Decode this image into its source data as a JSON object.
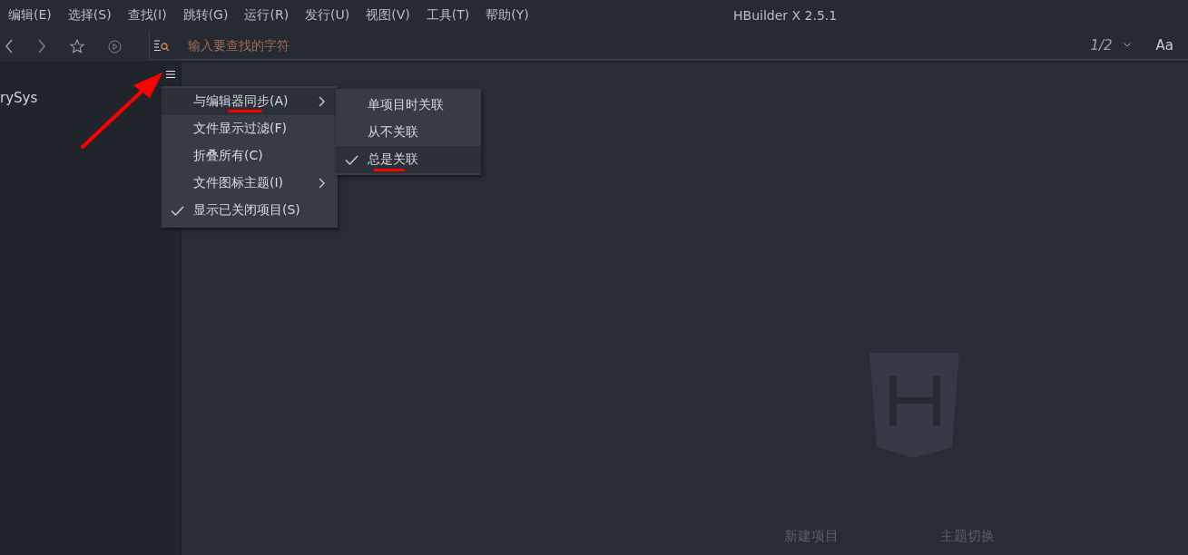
{
  "window": {
    "title": "HBuilder X 2.5.1"
  },
  "menu_bar": [
    "编辑(E)",
    "选择(S)",
    "查找(I)",
    "跳转(G)",
    "运行(R)",
    "发行(U)",
    "视图(V)",
    "工具(T)",
    "帮助(Y)"
  ],
  "toolbar": {
    "search": {
      "placeholder": "输入要查找的字符"
    },
    "match_count": "1/2",
    "case_toggle": "Aa"
  },
  "sidebar": {
    "items": [
      "rySys"
    ]
  },
  "context_menu": {
    "items": [
      {
        "label": "与编辑器同步(A)",
        "has_submenu": true,
        "checked": false,
        "selected": true
      },
      {
        "label": "文件显示过滤(F)",
        "has_submenu": false,
        "checked": false,
        "selected": false
      },
      {
        "label": "折叠所有(C)",
        "has_submenu": false,
        "checked": false,
        "selected": false
      },
      {
        "label": "文件图标主题(I)",
        "has_submenu": true,
        "checked": false,
        "selected": false
      },
      {
        "label": "显示已关闭项目(S)",
        "has_submenu": false,
        "checked": true,
        "selected": false
      }
    ]
  },
  "submenu": {
    "items": [
      {
        "label": "单项目时关联",
        "checked": false,
        "selected": false
      },
      {
        "label": "从不关联",
        "checked": false,
        "selected": false
      },
      {
        "label": "总是关联",
        "checked": true,
        "selected": true
      }
    ]
  },
  "welcome": {
    "links": [
      "新建项目",
      "主题切换"
    ]
  }
}
